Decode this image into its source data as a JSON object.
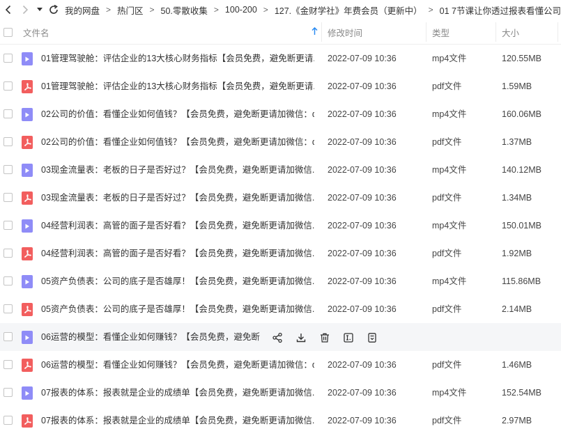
{
  "breadcrumb": [
    "我的网盘",
    "热门区",
    "50.零散收集",
    "100-200",
    "127.《金财学社》年费会员（更新中）",
    "01 7节课让你透过报表看懂公司"
  ],
  "header": {
    "name": "文件名",
    "modified": "修改时间",
    "type": "类型",
    "size": "大小"
  },
  "files": [
    {
      "name": "01管理驾驶舱：评估企业的13大核心财务指标【会员免费，避免断更请...",
      "date": "2022-07-09 10:36",
      "type": "mp4文件",
      "size": "120.55MB",
      "kind": "video"
    },
    {
      "name": "01管理驾驶舱：评估企业的13大核心财务指标【会员免费，避免断更请...",
      "date": "2022-07-09 10:36",
      "type": "pdf文件",
      "size": "1.59MB",
      "kind": "pdf"
    },
    {
      "name": "02公司的价值：看懂企业如何值钱？【会员免费，避免断更请加微信：q...",
      "date": "2022-07-09 10:36",
      "type": "mp4文件",
      "size": "160.06MB",
      "kind": "video"
    },
    {
      "name": "02公司的价值：看懂企业如何值钱？【会员免费，避免断更请加微信：q...",
      "date": "2022-07-09 10:36",
      "type": "pdf文件",
      "size": "1.37MB",
      "kind": "pdf"
    },
    {
      "name": "03现金流量表：老板的日子是否好过？【会员免费，避免断更请加微信...",
      "date": "2022-07-09 10:36",
      "type": "mp4文件",
      "size": "140.12MB",
      "kind": "video"
    },
    {
      "name": "03现金流量表：老板的日子是否好过？【会员免费，避免断更请加微信...",
      "date": "2022-07-09 10:36",
      "type": "pdf文件",
      "size": "1.34MB",
      "kind": "pdf"
    },
    {
      "name": "04经营利润表：高管的面子是否好看？【会员免费，避免断更请加微信...",
      "date": "2022-07-09 10:36",
      "type": "mp4文件",
      "size": "150.01MB",
      "kind": "video"
    },
    {
      "name": "04经营利润表：高管的面子是否好看？【会员免费，避免断更请加微信...",
      "date": "2022-07-09 10:36",
      "type": "pdf文件",
      "size": "1.92MB",
      "kind": "pdf"
    },
    {
      "name": "05资产负债表：公司的底子是否雄厚！【会员免费，避免断更请加微信...",
      "date": "2022-07-09 10:36",
      "type": "mp4文件",
      "size": "115.86MB",
      "kind": "video"
    },
    {
      "name": "05资产负债表：公司的底子是否雄厚！【会员免费，避免断更请加微信...",
      "date": "2022-07-09 10:36",
      "type": "pdf文件",
      "size": "2.14MB",
      "kind": "pdf"
    },
    {
      "name": "06运营的模型：看懂企业如何赚钱？【会员免费，避免断...",
      "date": "",
      "type": "",
      "size": "",
      "kind": "video"
    },
    {
      "name": "06运营的模型：看懂企业如何赚钱？【会员免费，避免断更请加微信：q...",
      "date": "2022-07-09 10:36",
      "type": "pdf文件",
      "size": "1.46MB",
      "kind": "pdf"
    },
    {
      "name": "07报表的体系：报表就是企业的成绩单【会员免费，避免断更请加微信...",
      "date": "2022-07-09 10:36",
      "type": "mp4文件",
      "size": "152.54MB",
      "kind": "video"
    },
    {
      "name": "07报表的体系：报表就是企业的成绩单【会员免费，避免断更请加微信...",
      "date": "2022-07-09 10:36",
      "type": "pdf文件",
      "size": "2.97MB",
      "kind": "pdf"
    }
  ],
  "hover_row_index": 10,
  "hover_actions": [
    "share-icon",
    "download-icon",
    "delete-icon",
    "rename-icon",
    "more-icon"
  ],
  "colors": {
    "video_icon": "#8f8cf7",
    "pdf_icon": "#f25e5e",
    "hover_bg": "#f5f6f8",
    "sort_arrow": "#2a8bf2"
  }
}
